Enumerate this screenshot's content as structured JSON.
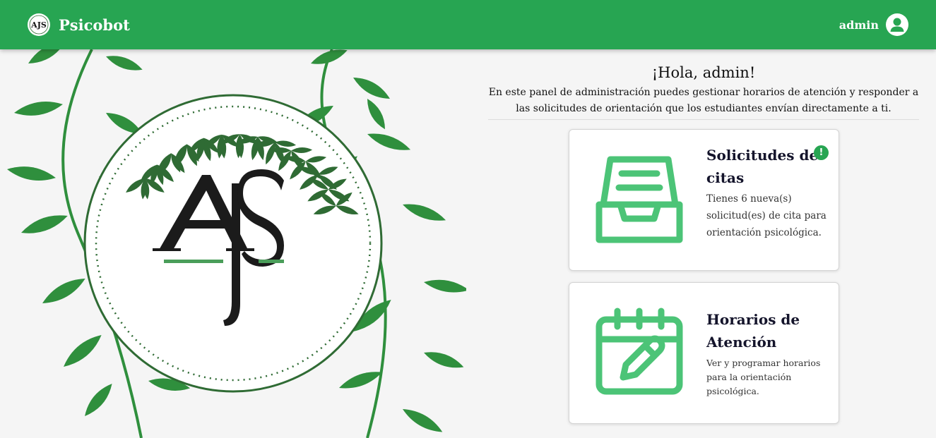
{
  "navbar": {
    "brand": "Psicobot",
    "user": "admin",
    "logo_text": "AJS"
  },
  "hero": {
    "monogram": "AJS"
  },
  "panel": {
    "greeting": "¡Hola, admin!",
    "intro": "En este panel de administración puedes gestionar horarios de atención y responder a las solicitudes de orientación que los estudiantes envían directamente a ti."
  },
  "cards": [
    {
      "title": "Solicitudes de citas",
      "description": "Tienes 6 nueva(s) solicitud(es) de cita para orientación psicológica.",
      "badge": "!",
      "icon": "inbox-tray-icon"
    },
    {
      "title": "Horarios de Atención",
      "description": "Ver y programar horarios para la orientación psicológica.",
      "icon": "calendar-edit-icon"
    }
  ],
  "colors": {
    "primary": "#27a552",
    "icon_green": "#4cc477",
    "leaf_green": "#2f8f3d",
    "laurel_dark": "#2f6b34"
  }
}
